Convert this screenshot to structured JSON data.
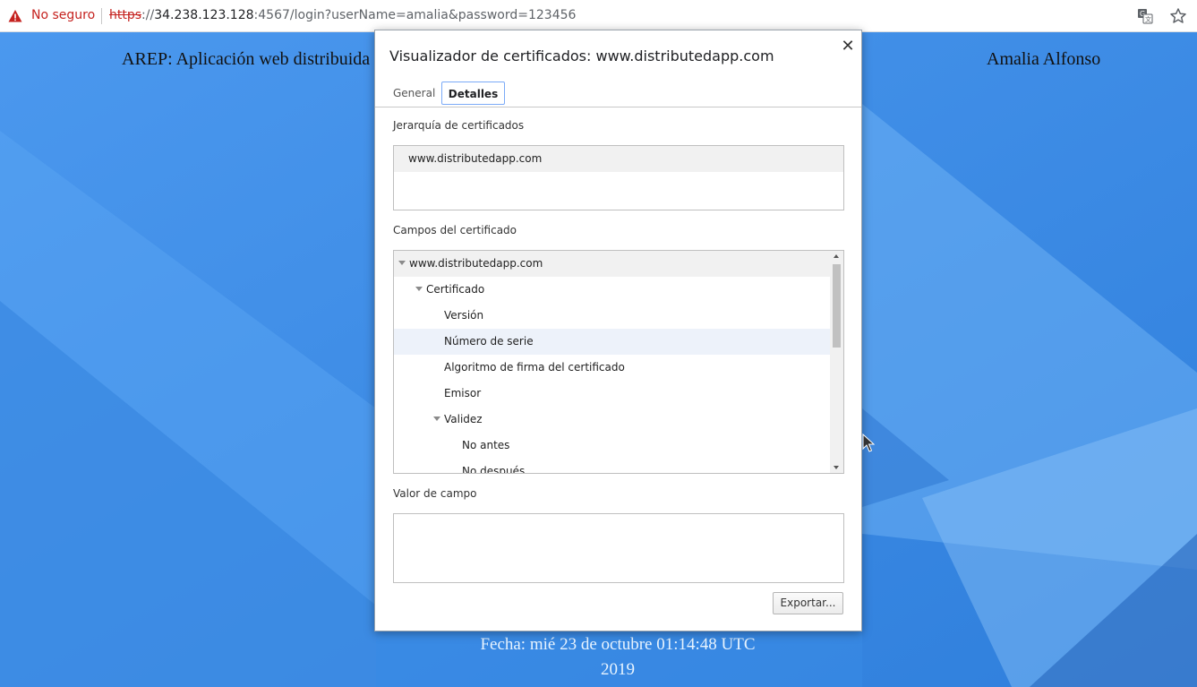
{
  "browser": {
    "security_label": "No seguro",
    "url_scheme": "https",
    "url_separator": "://",
    "url_host": "34.238.123.128",
    "url_rest": ":4567/login?userName=amalia&password=123456",
    "icons": [
      "warning-icon",
      "translate-icon",
      "star-icon"
    ]
  },
  "page": {
    "title": "AREP: Aplicación web distribuida",
    "author": "Amalia Alfonso",
    "date_line1": "Fecha: mié 23 de octubre 01:14:48 UTC",
    "date_line2": "2019"
  },
  "dialog": {
    "title": "Visualizador de certificados: www.distributedapp.com",
    "close_icon": "close-icon",
    "tabs": [
      {
        "label": "General",
        "active": false
      },
      {
        "label": "Detalles",
        "active": true
      }
    ],
    "hierarchy_label": "Jerarquía de certificados",
    "hierarchy_items": [
      "www.distributedapp.com"
    ],
    "fields_label": "Campos del certificado",
    "fields": [
      {
        "label": "www.distributedapp.com",
        "level": 0,
        "expanded": true
      },
      {
        "label": "Certificado",
        "level": 1,
        "expanded": true
      },
      {
        "label": "Versión",
        "level": 2
      },
      {
        "label": "Número de serie",
        "level": 2
      },
      {
        "label": "Algoritmo de firma del certificado",
        "level": 2
      },
      {
        "label": "Emisor",
        "level": 2
      },
      {
        "label": "Validez",
        "level": 2,
        "expanded": true
      },
      {
        "label": "No antes",
        "level": 3
      },
      {
        "label": "No después",
        "level": 3
      }
    ],
    "value_label": "Valor de campo",
    "value_text": "",
    "export_button": "Exportar..."
  },
  "colors": {
    "background": "#3f8fe6",
    "insecure": "#c5221f",
    "accent": "#7baaf7"
  }
}
